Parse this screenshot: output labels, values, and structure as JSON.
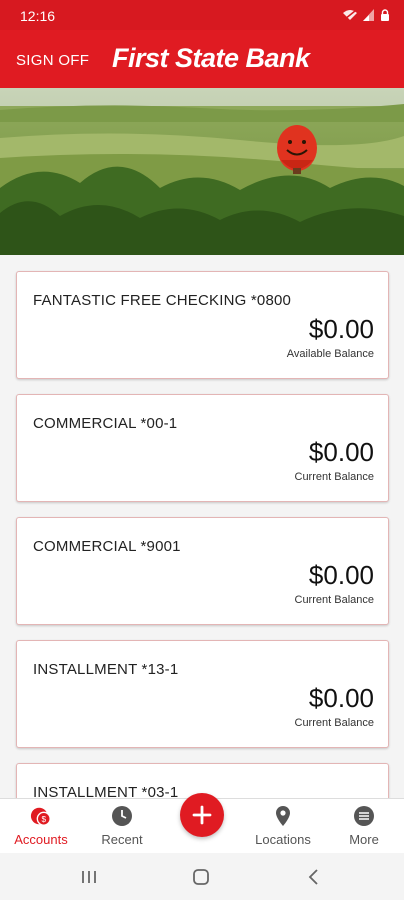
{
  "status": {
    "time": "12:16"
  },
  "header": {
    "sign_off": "SIGN OFF",
    "bank_name": "First State Bank"
  },
  "accounts": [
    {
      "name": "FANTASTIC FREE CHECKING *0800",
      "amount": "$0.00",
      "balance_label": "Available Balance"
    },
    {
      "name": "COMMERCIAL *00-1",
      "amount": "$0.00",
      "balance_label": "Current Balance"
    },
    {
      "name": "COMMERCIAL *9001",
      "amount": "$0.00",
      "balance_label": "Current Balance"
    },
    {
      "name": "INSTALLMENT *13-1",
      "amount": "$0.00",
      "balance_label": "Current Balance"
    },
    {
      "name": "INSTALLMENT *03-1",
      "amount": "",
      "balance_label": ""
    }
  ],
  "nav": {
    "accounts": "Accounts",
    "accounts_badge": "$",
    "recent": "Recent",
    "locations": "Locations",
    "more": "More"
  },
  "colors": {
    "brand": "#e01b22",
    "status_bar": "#d71920"
  },
  "icons": [
    "wifi-icon",
    "signal-icon",
    "lock-icon",
    "accounts-icon",
    "clock-icon",
    "plus-icon",
    "location-pin-icon",
    "more-icon",
    "recents-icon",
    "home-icon",
    "back-icon"
  ]
}
